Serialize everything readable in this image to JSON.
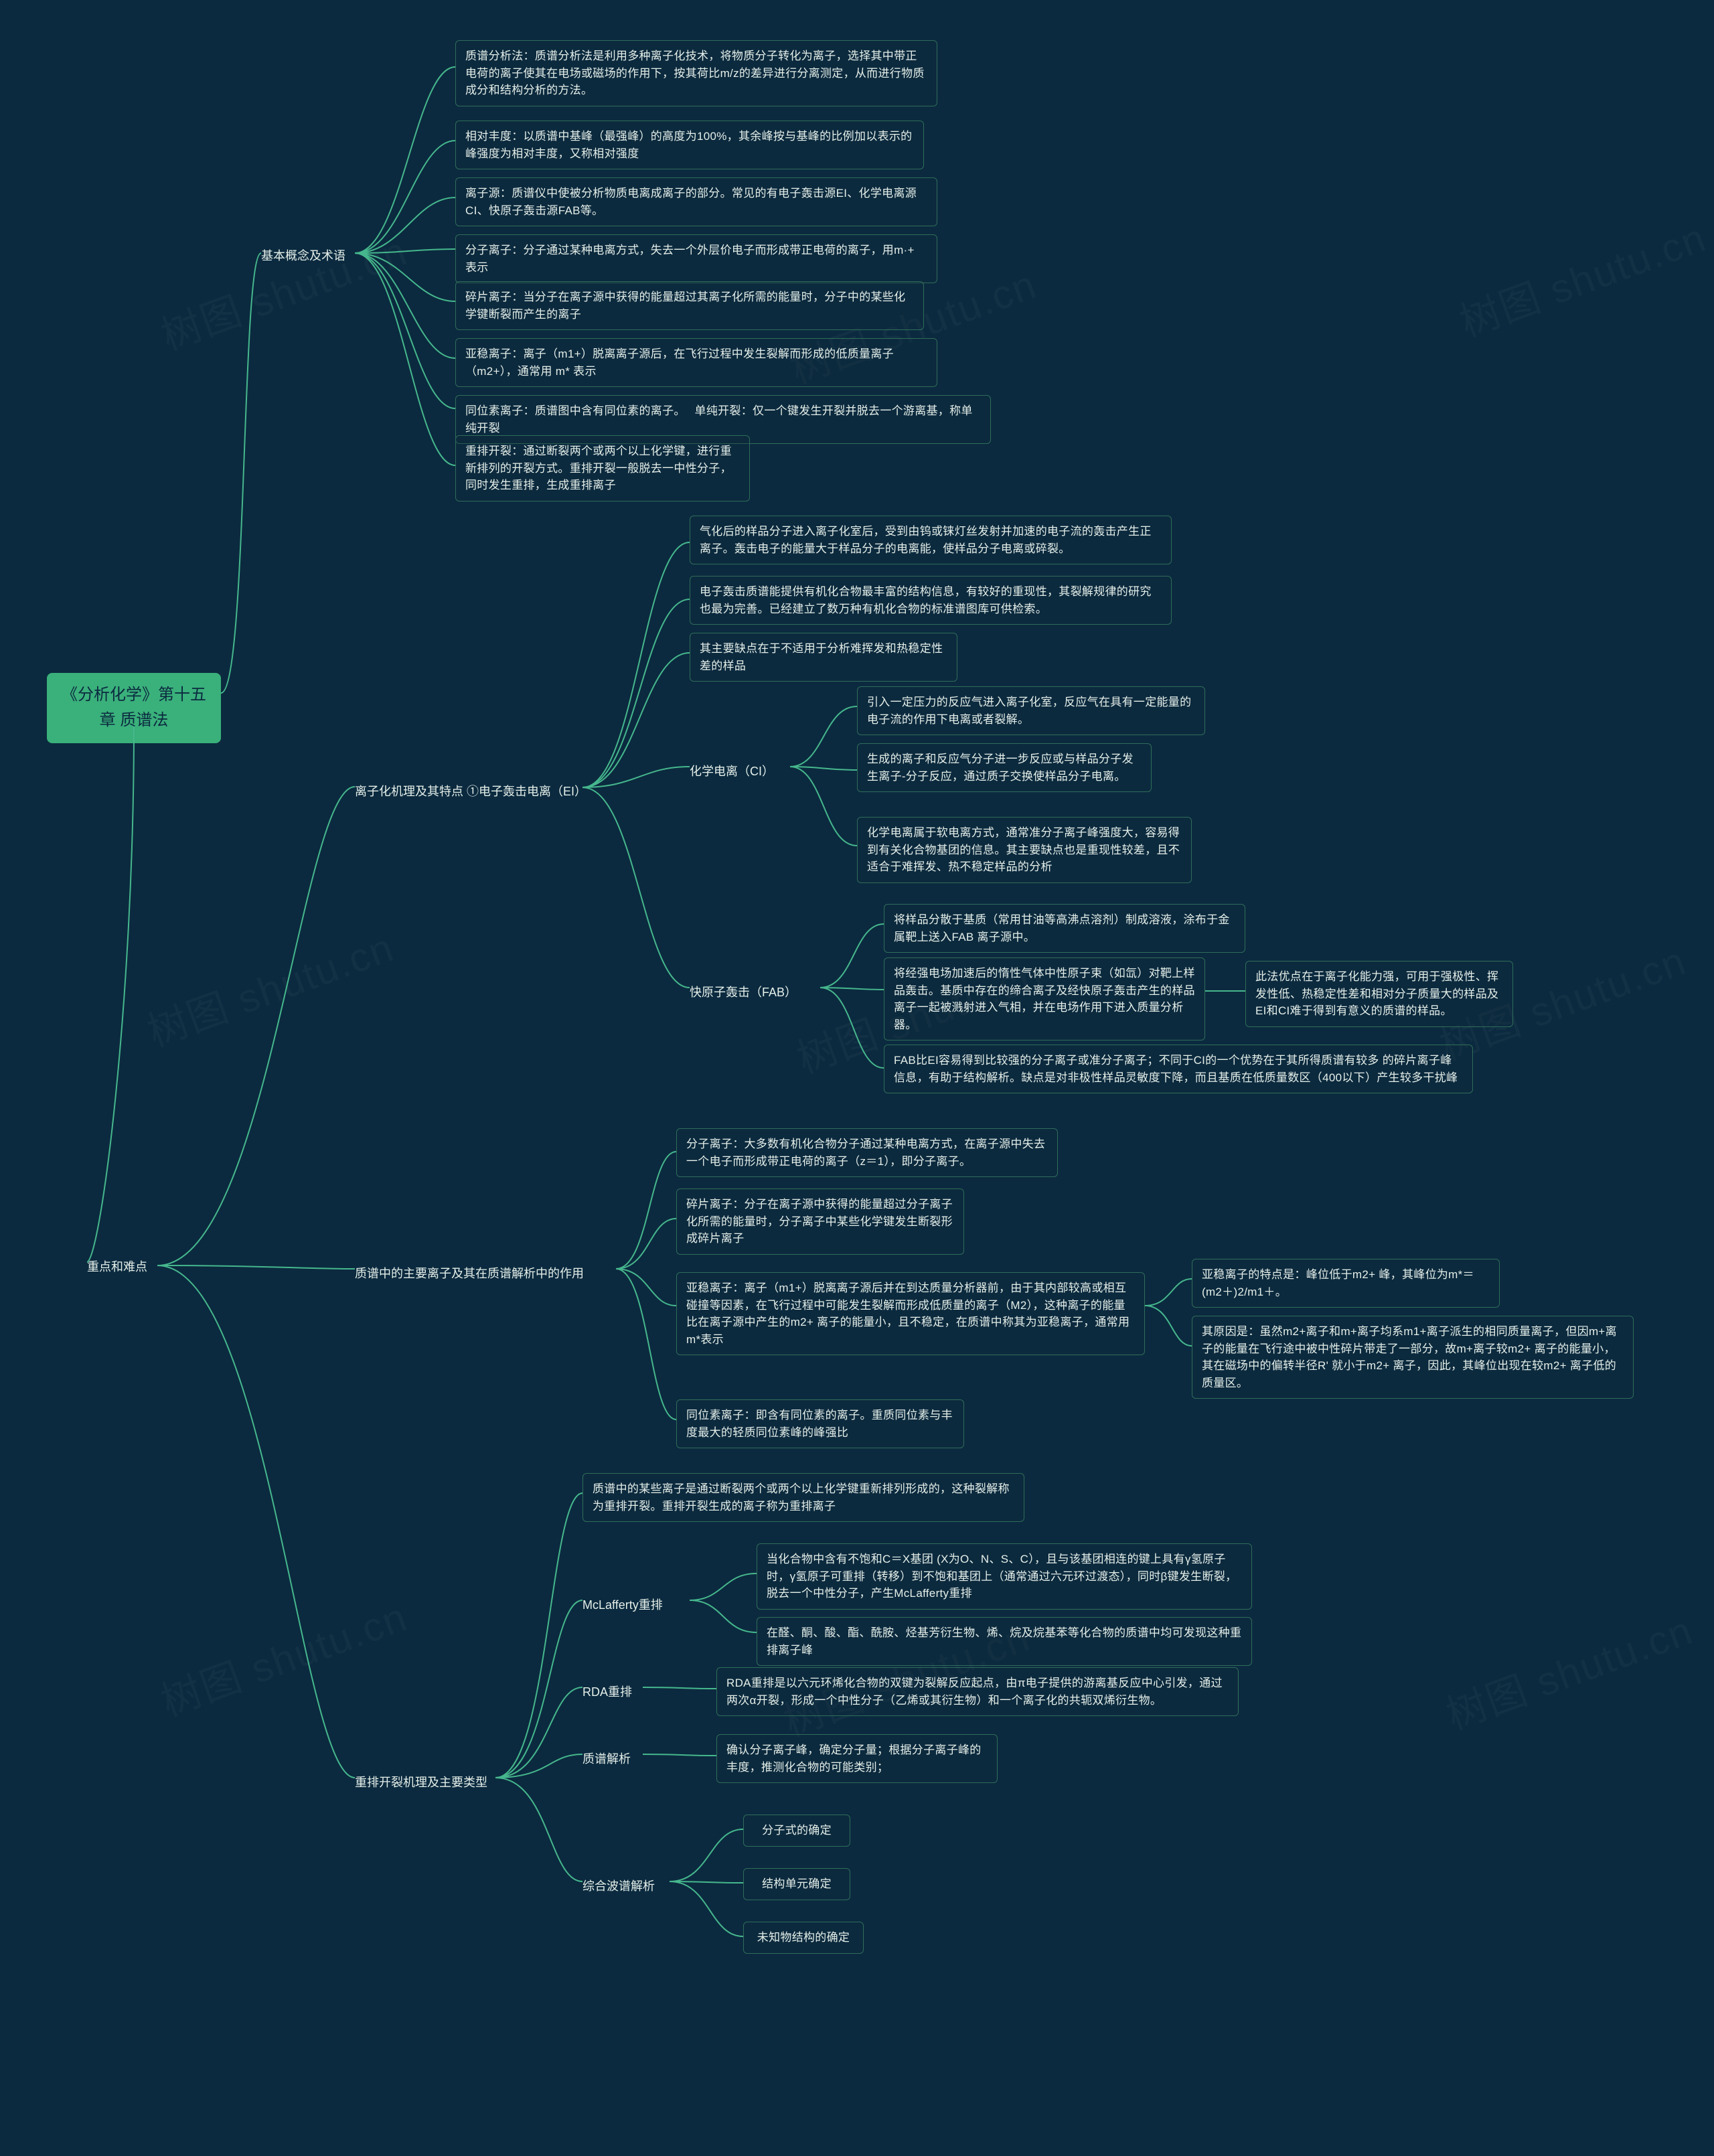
{
  "watermark": "树图 shutu.cn",
  "root_title": "《分析化学》第十五章 质谱法",
  "level1": {
    "key_difficult": "重点和难点"
  },
  "branches": {
    "basic": "基本概念及术语",
    "ioniz": "离子化机理及其特点 ①电子轰击电离（EI）",
    "mainions": "质谱中的主要离子及其在质谱解析中的作用",
    "rearr": "重排开裂机理及主要类型"
  },
  "basic_nodes": {
    "n1": "质谱分析法：质谱分析法是利用多种离子化技术，将物质分子转化为离子，选择其中带正电荷的离子使其在电场或磁场的作用下，按其荷比m/z的差异进行分离测定，从而进行物质成分和结构分析的方法。",
    "n2": "相对丰度：以质谱中基峰（最强峰）的高度为100%，其余峰按与基峰的比例加以表示的峰强度为相对丰度，又称相对强度",
    "n3": "离子源：质谱仪中使被分析物质电离成离子的部分。常见的有电子轰击源EI、化学电离源CI、快原子轰击源FAB等。",
    "n4": "分子离子：分子通过某种电离方式，失去一个外层价电子而形成带正电荷的离子，用m·+ 表示",
    "n5": "碎片离子：当分子在离子源中获得的能量超过其离子化所需的能量时，分子中的某些化学键断裂而产生的离子",
    "n6": "亚稳离子：离子（m1+）脱离离子源后，在飞行过程中发生裂解而形成的低质量离子（m2+），通常用 m* 表示",
    "n7": "同位素离子：质谱图中含有同位素的离子。　    单纯开裂：仅一个键发生开裂并脱去一个游离基，称单纯开裂",
    "n8": "重排开裂：通过断裂两个或两个以上化学键，进行重新排列的开裂方式。重排开裂一般脱去一中性分子，同时发生重排，生成重排离子"
  },
  "ioniz_top": {
    "i1": "气化后的样品分子进入离子化室后，受到由钨或铼灯丝发射并加速的电子流的轰击产生正离子。轰击电子的能量大于样品分子的电离能，使样品分子电离或碎裂。",
    "i2": "电子轰击质谱能提供有机化合物最丰富的结构信息，有较好的重现性，其裂解规律的研究也最为完善。已经建立了数万种有机化合物的标准谱图库可供检索。",
    "i3": "其主要缺点在于不适用于分析难挥发和热稳定性差的样品"
  },
  "chem_label": "化学电离（CI）",
  "chem_nodes": {
    "c1": "引入一定压力的反应气进入离子化室，反应气在具有一定能量的电子流的作用下电离或者裂解。",
    "c2": "生成的离子和反应气分子进一步反应或与样品分子发生离子-分子反应，通过质子交换使样品分子电离。",
    "c3": "化学电离属于软电离方式，通常准分子离子峰强度大，容易得到有关化合物基团的信息。其主要缺点也是重现性较差，且不适合于难挥发、热不稳定样品的分析"
  },
  "fab_label": "快原子轰击（FAB）",
  "fab_nodes": {
    "f1": "将样品分散于基质（常用甘油等高沸点溶剂）制成溶液，涂布于金属靶上送入FAB 离子源中。",
    "f2": "将经强电场加速后的惰性气体中性原子束（如氙）对靶上样品轰击。基质中存在的缔合离子及经快原子轰击产生的样品离子一起被溅射进入气相，并在电场作用下进入质量分析器。",
    "f2a": "此法优点在于离子化能力强，可用于强极性、挥发性低、热稳定性差和相对分子质量大的样品及EI和CI难于得到有意义的质谱的样品。",
    "f3": "FAB比EI容易得到比较强的分子离子或准分子离子；不同于CI的一个优势在于其所得质谱有较多 的碎片离子峰信息，有助于结构解析。缺点是对非极性样品灵敏度下降，而且基质在低质量数区（400以下）产生较多干扰峰"
  },
  "mainions_nodes": {
    "m1": "分子离子：大多数有机化合物分子通过某种电离方式，在离子源中失去一个电子而形成带正电荷的离子（z＝1），即分子离子。",
    "m2": "碎片离子：分子在离子源中获得的能量超过分子离子化所需的能量时，分子离子中某些化学键发生断裂形成碎片离子",
    "m3": "亚稳离子：离子（m1+）脱离离子源后并在到达质量分析器前，由于其内部较高或相互碰撞等因素，在飞行过程中可能发生裂解而形成低质量的离子（M2），这种离子的能量比在离子源中产生的m2+ 离子的能量小，且不稳定，在质谱中称其为亚稳离子，通常用m*表示",
    "m3a": "亚稳离子的特点是：峰位低于m2+ 峰，其峰位为m*＝(m2＋)2/m1＋。",
    "m3b": "其原因是：虽然m2+离子和m+离子均系m1+离子派生的相同质量离子，但因m+离子的能量在飞行途中被中性碎片带走了一部分，故m+离子较m2+ 离子的能量小，其在磁场中的偏转半径R' 就小于m2+ 离子，因此，其峰位出现在较m2+ 离子低的质量区。",
    "m4": "同位素离子：即含有同位素的离子。重质同位素与丰度最大的轻质同位素峰的峰强比"
  },
  "rearr_nodes": {
    "r1": "质谱中的某些离子是通过断裂两个或两个以上化学键重新排列形成的，这种裂解称为重排开裂。重排开裂生成的离子称为重排离子",
    "mcl_label": "McLafferty重排",
    "mcl1": "当化合物中含有不饱和C＝X基团 (X为O、N、S、C），且与该基团相连的键上具有γ氢原子时，γ氢原子可重排（转移）到不饱和基团上（通常通过六元环过渡态），同时β键发生断裂，脱去一个中性分子，产生McLafferty重排",
    "mcl2": "在醛、酮、酸、酯、酰胺、烃基芳衍生物、烯、烷及烷基苯等化合物的质谱中均可发现这种重排离子峰",
    "rda_label": "RDA重排",
    "rda1": "RDA重排是以六元环烯化合物的双键为裂解反应起点，由π电子提供的游离基反应中心引发，通过两次α开裂，形成一个中性分子（乙烯或其衍生物）和一个离子化的共轭双烯衍生物。",
    "parse_label": "质谱解析",
    "parse1": "确认分子离子峰，确定分子量；根据分子离子峰的丰度，推测化合物的可能类别；",
    "zh_label": "综合波谱解析",
    "zh1": "分子式的确定",
    "zh2": "结构单元确定",
    "zh3": "未知物结构的确定"
  }
}
